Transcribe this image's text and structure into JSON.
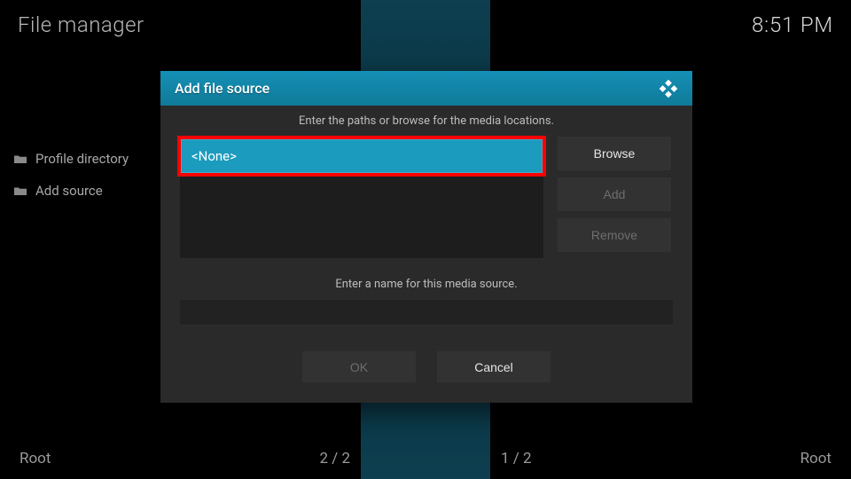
{
  "header": {
    "title": "File manager",
    "clock": "8:51 PM"
  },
  "sidebar": {
    "items": [
      {
        "label": "Profile directory"
      },
      {
        "label": "Add source"
      }
    ]
  },
  "footer": {
    "left_label": "Root",
    "center_left": "2 / 2",
    "center_right": "1 / 2",
    "right_label": "Root"
  },
  "dialog": {
    "title": "Add file source",
    "instruction_paths": "Enter the paths or browse for the media locations.",
    "path_value": "<None>",
    "buttons": {
      "browse": "Browse",
      "add": "Add",
      "remove": "Remove"
    },
    "instruction_name": "Enter a name for this media source.",
    "name_value": "",
    "ok": "OK",
    "cancel": "Cancel"
  }
}
